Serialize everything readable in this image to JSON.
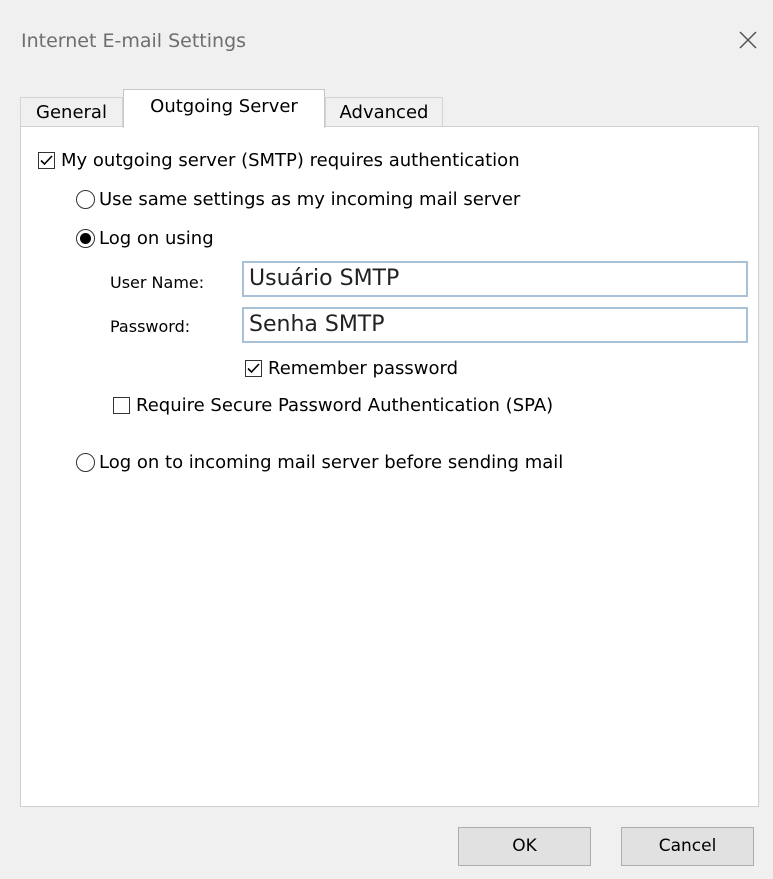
{
  "window": {
    "title": "Internet E-mail Settings",
    "close_icon": "close-icon"
  },
  "tabs": [
    {
      "label": "General",
      "active": false
    },
    {
      "label": "Outgoing Server",
      "active": true
    },
    {
      "label": "Advanced",
      "active": false
    }
  ],
  "outgoing": {
    "smtp_auth_label": "My outgoing server (SMTP) requires authentication",
    "smtp_auth_checked": true,
    "same_settings_label": "Use same settings as my incoming mail server",
    "same_settings_selected": false,
    "log_on_using_label": "Log on using",
    "log_on_using_selected": true,
    "username_label": "User Name:",
    "username_value": "Usuário SMTP",
    "password_label": "Password:",
    "password_value": "Senha SMTP",
    "remember_label": "Remember password",
    "remember_checked": true,
    "spa_label": "Require Secure Password Authentication (SPA)",
    "spa_checked": false,
    "log_on_incoming_label": "Log on to incoming mail server before sending mail",
    "log_on_incoming_selected": false
  },
  "buttons": {
    "ok_label": "OK",
    "cancel_label": "Cancel"
  }
}
